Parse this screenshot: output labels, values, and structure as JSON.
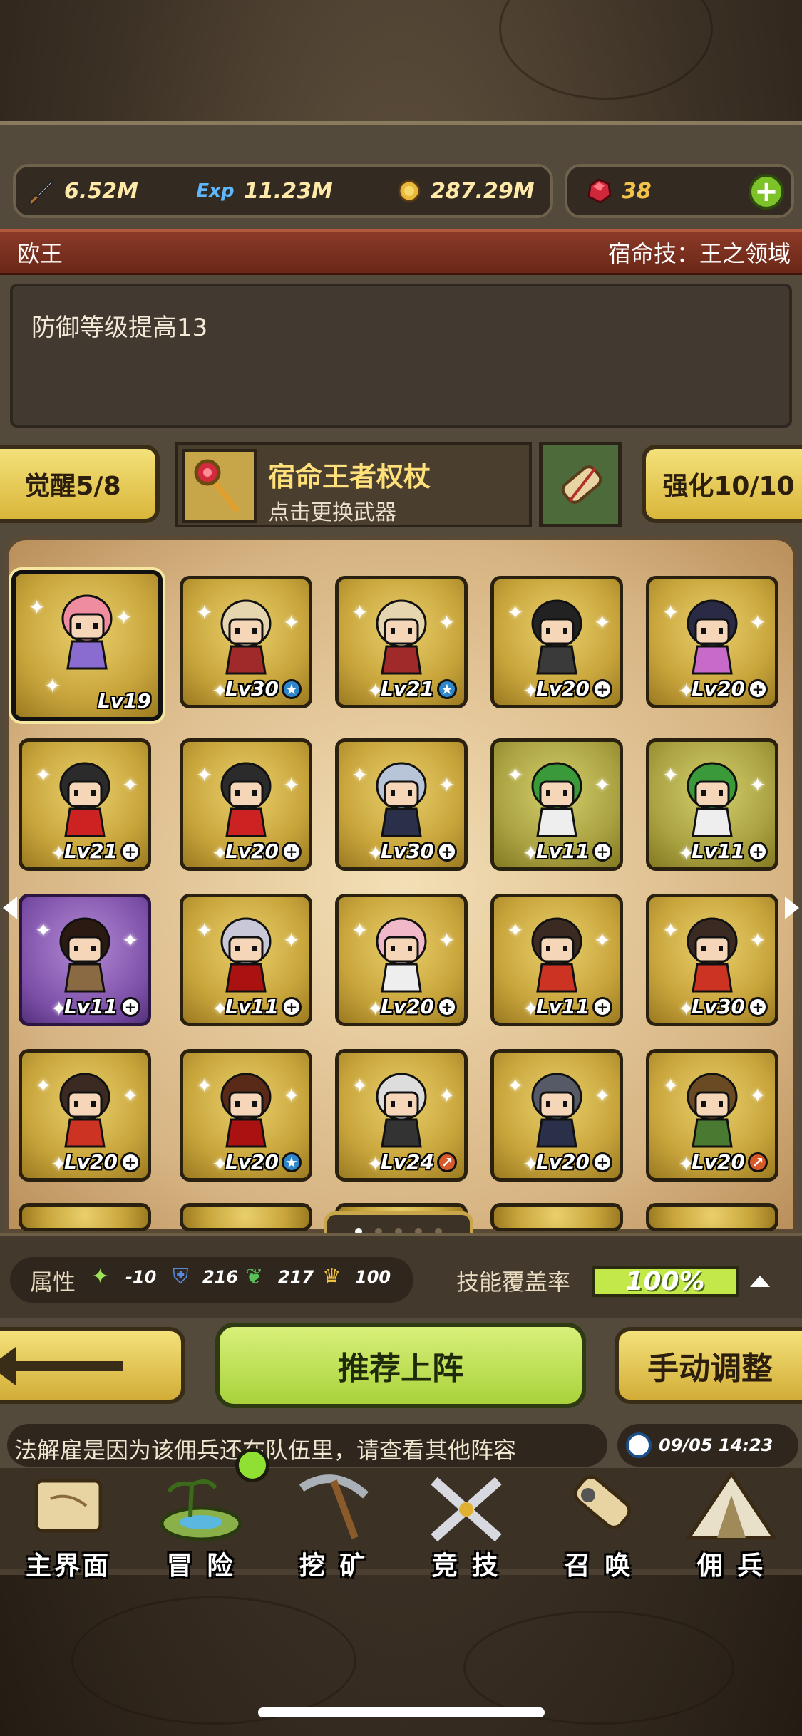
{
  "resources": {
    "attack": "6.52M",
    "exp": "11.23M",
    "gold": "287.29M",
    "gems": "38",
    "exp_icon_text": "Exp"
  },
  "fate": {
    "name": "欧王",
    "skill": "宿命技：王之领域",
    "description": "防御等级提高13"
  },
  "buttons": {
    "awaken": "觉醒5/8",
    "enhance": "强化10/10",
    "recommend": "推荐上阵",
    "manual": "手动调整"
  },
  "weapon": {
    "name": "宿命王者权杖",
    "hint": "点击更换武器"
  },
  "heroes": [
    {
      "level": "Lv19",
      "badge": "",
      "tier": "gold",
      "selected": true,
      "hair": "#f08ca0",
      "outfit": "#8a6bd0"
    },
    {
      "level": "Lv30",
      "badge": "star",
      "tier": "gold",
      "hair": "#e6d6b0",
      "outfit": "#a02a2a"
    },
    {
      "level": "Lv21",
      "badge": "star",
      "tier": "gold",
      "hair": "#e6d6b0",
      "outfit": "#a02a2a"
    },
    {
      "level": "Lv20",
      "badge": "plus",
      "tier": "gold",
      "hair": "#222",
      "outfit": "#3a3a3a"
    },
    {
      "level": "Lv20",
      "badge": "plus",
      "tier": "gold",
      "hair": "#2a2a44",
      "outfit": "#c86ac8"
    },
    {
      "level": "Lv21",
      "badge": "plus",
      "tier": "gold",
      "hair": "#2b2b2b",
      "outfit": "#c22"
    },
    {
      "level": "Lv20",
      "badge": "plus",
      "tier": "gold",
      "hair": "#2b2b2b",
      "outfit": "#c22"
    },
    {
      "level": "Lv30",
      "badge": "plus",
      "tier": "gold",
      "hair": "#b8c4d8",
      "outfit": "#2a2f4a"
    },
    {
      "level": "Lv11",
      "badge": "plus",
      "tier": "green",
      "hair": "#3a9a3a",
      "outfit": "#eee"
    },
    {
      "level": "Lv11",
      "badge": "plus",
      "tier": "green",
      "hair": "#3a9a3a",
      "outfit": "#eee"
    },
    {
      "level": "Lv11",
      "badge": "plus",
      "tier": "purple",
      "hair": "#2a1a12",
      "outfit": "#8a6a42"
    },
    {
      "level": "Lv11",
      "badge": "plus",
      "tier": "gold",
      "hair": "#c8c8d8",
      "outfit": "#a11"
    },
    {
      "level": "Lv20",
      "badge": "plus",
      "tier": "gold",
      "hair": "#f0b8c8",
      "outfit": "#eee"
    },
    {
      "level": "Lv11",
      "badge": "plus",
      "tier": "gold",
      "hair": "#3a2a22",
      "outfit": "#c32"
    },
    {
      "level": "Lv30",
      "badge": "plus",
      "tier": "gold",
      "hair": "#3a2a22",
      "outfit": "#c32"
    },
    {
      "level": "Lv20",
      "badge": "plus",
      "tier": "gold",
      "hair": "#3a2a22",
      "outfit": "#c32"
    },
    {
      "level": "Lv20",
      "badge": "star",
      "tier": "gold",
      "hair": "#5a2a18",
      "outfit": "#a11"
    },
    {
      "level": "Lv24",
      "badge": "up",
      "tier": "gold",
      "hair": "#ddd",
      "outfit": "#333"
    },
    {
      "level": "Lv20",
      "badge": "plus",
      "tier": "gold",
      "hair": "#555a66",
      "outfit": "#2a2f4a"
    },
    {
      "level": "Lv20",
      "badge": "up",
      "tier": "gold",
      "hair": "#6a4a22",
      "outfit": "#4a7a32"
    }
  ],
  "attributes": {
    "label": "属性",
    "wind": "-10",
    "shield": "216",
    "leaf": "217",
    "crown": "100",
    "skill_coverage_label": "技能覆盖率",
    "skill_coverage": "100%"
  },
  "message": "法解雇是因为该佣兵还在队伍里，请查看其他阵容",
  "timestamp": "09/05 14:23",
  "nav": [
    {
      "label": "主界面",
      "icon": "map-scroll-icon"
    },
    {
      "label": "冒 险",
      "icon": "island-icon"
    },
    {
      "label": "挖 矿",
      "icon": "pickaxe-icon"
    },
    {
      "label": "竞 技",
      "icon": "crossed-swords-icon"
    },
    {
      "label": "召 唤",
      "icon": "summon-scroll-icon"
    },
    {
      "label": "佣 兵",
      "icon": "tent-icon"
    }
  ],
  "colors": {
    "accent_gold": "#f4e17a",
    "accent_green": "#c2e84a",
    "title_red": "#8b3a28"
  }
}
